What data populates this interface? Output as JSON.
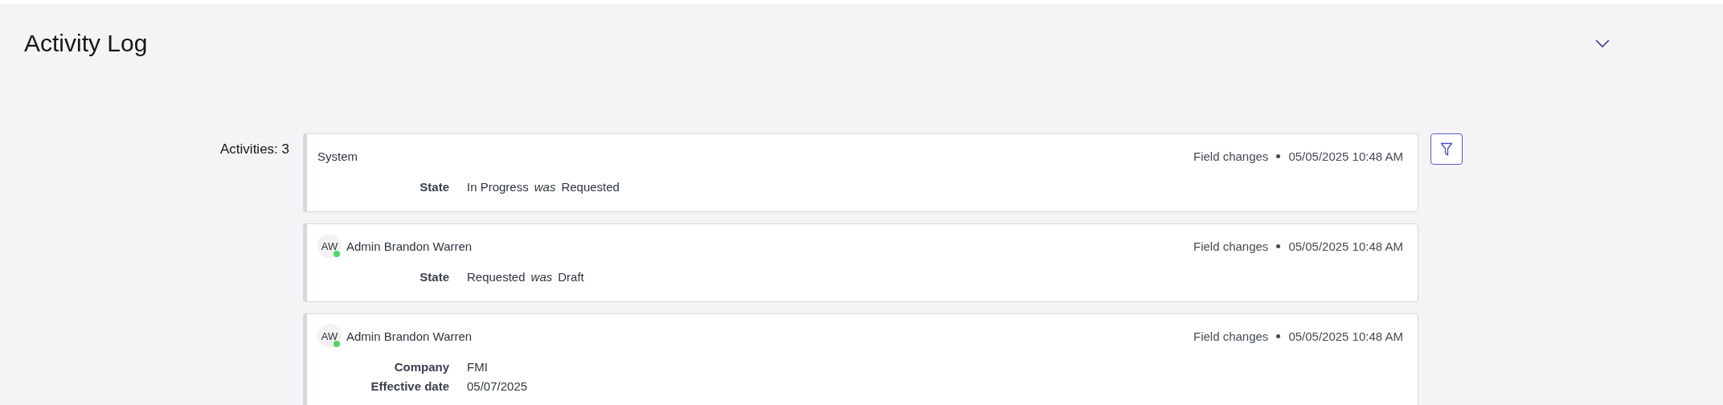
{
  "header": {
    "title": "Activity Log",
    "expanded": true
  },
  "activities_label": "Activities: 3",
  "entries": [
    {
      "author": "System",
      "type": "Field changes",
      "timestamp": "05/05/2025 10:48 AM",
      "changes": [
        {
          "label": "State",
          "value": "In Progress",
          "connector": "was",
          "previous": "Requested"
        }
      ]
    },
    {
      "author": "Admin Brandon Warren",
      "avatar": {
        "initials": "AW",
        "online": true
      },
      "type": "Field changes",
      "timestamp": "05/05/2025 10:48 AM",
      "changes": [
        {
          "label": "State",
          "value": "Requested",
          "connector": "was",
          "previous": "Draft"
        }
      ]
    },
    {
      "author": "Admin Brandon Warren",
      "avatar": {
        "initials": "AW",
        "online": true
      },
      "type": "Field changes",
      "timestamp": "05/05/2025 10:48 AM",
      "changes": [
        {
          "label": "Company",
          "value": "FMI"
        },
        {
          "label": "Effective date",
          "value": "05/07/2025"
        }
      ]
    }
  ]
}
